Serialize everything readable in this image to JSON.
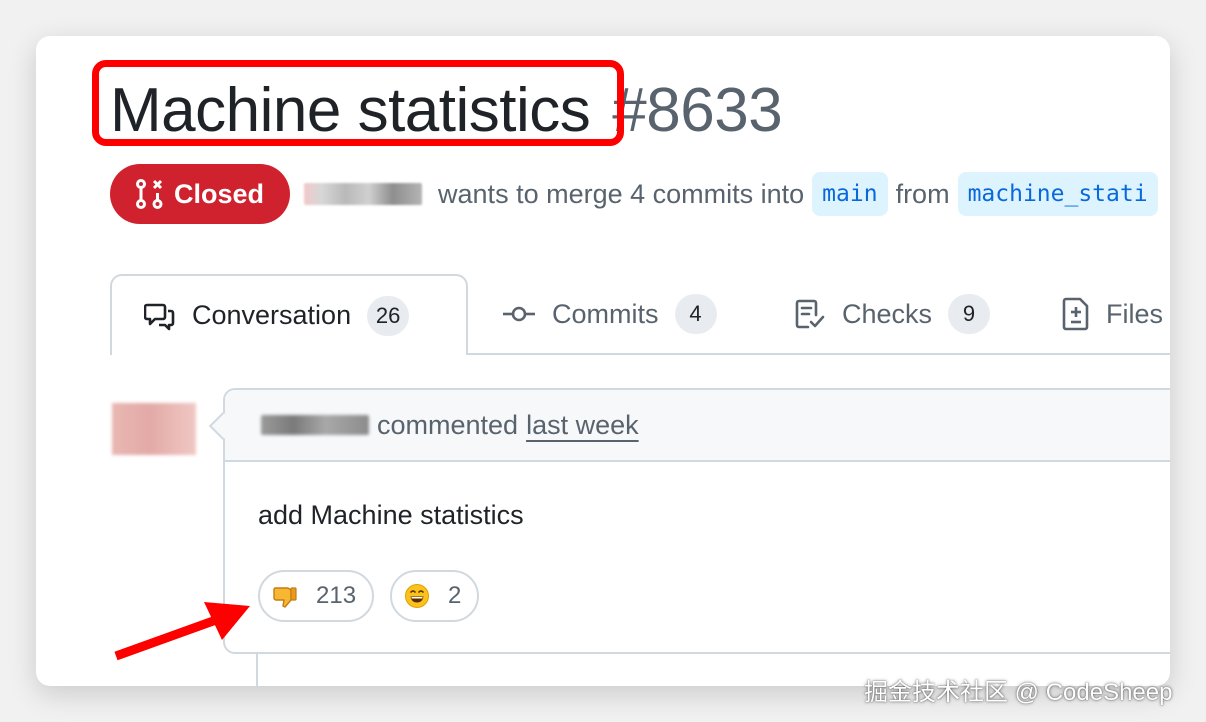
{
  "pr": {
    "title": "Machine statistics",
    "number": "#8633",
    "state": "Closed",
    "merge_text": "wants to merge 4 commits into",
    "base_branch": "main",
    "from_text": "from",
    "head_branch": "machine_stati"
  },
  "tabs": [
    {
      "label": "Conversation",
      "count": "26",
      "icon": "comment-discussion-icon"
    },
    {
      "label": "Commits",
      "count": "4",
      "icon": "commit-icon"
    },
    {
      "label": "Checks",
      "count": "9",
      "icon": "checklist-icon"
    },
    {
      "label": "Files",
      "icon": "file-diff-icon"
    }
  ],
  "comment": {
    "verb": "commented",
    "time": "last week",
    "body": "add Machine statistics",
    "reactions": [
      {
        "emoji": "thumbs-down",
        "count": "213"
      },
      {
        "emoji": "grinning-face",
        "count": "2"
      }
    ]
  },
  "colors": {
    "closed_badge": "#cf222e",
    "highlight_box": "#ff0000",
    "branch_text": "#0969da",
    "branch_bg": "#ddf4ff"
  },
  "watermark": "掘金技术社区 @ CodeSheep"
}
